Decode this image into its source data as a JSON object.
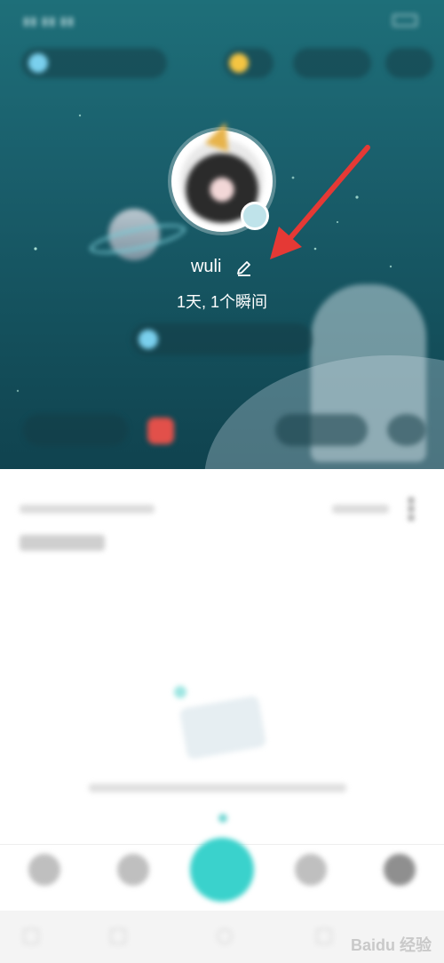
{
  "profile": {
    "username": "wuli",
    "stats": "1天, 1个瞬间"
  },
  "colors": {
    "hero_bg": "#1a5f6c",
    "accent": "#3ad2cc",
    "arrow": "#e53935"
  },
  "icons": {
    "edit": "pencil-icon",
    "arrow": "red-arrow"
  },
  "watermark": "Baidu 经验"
}
